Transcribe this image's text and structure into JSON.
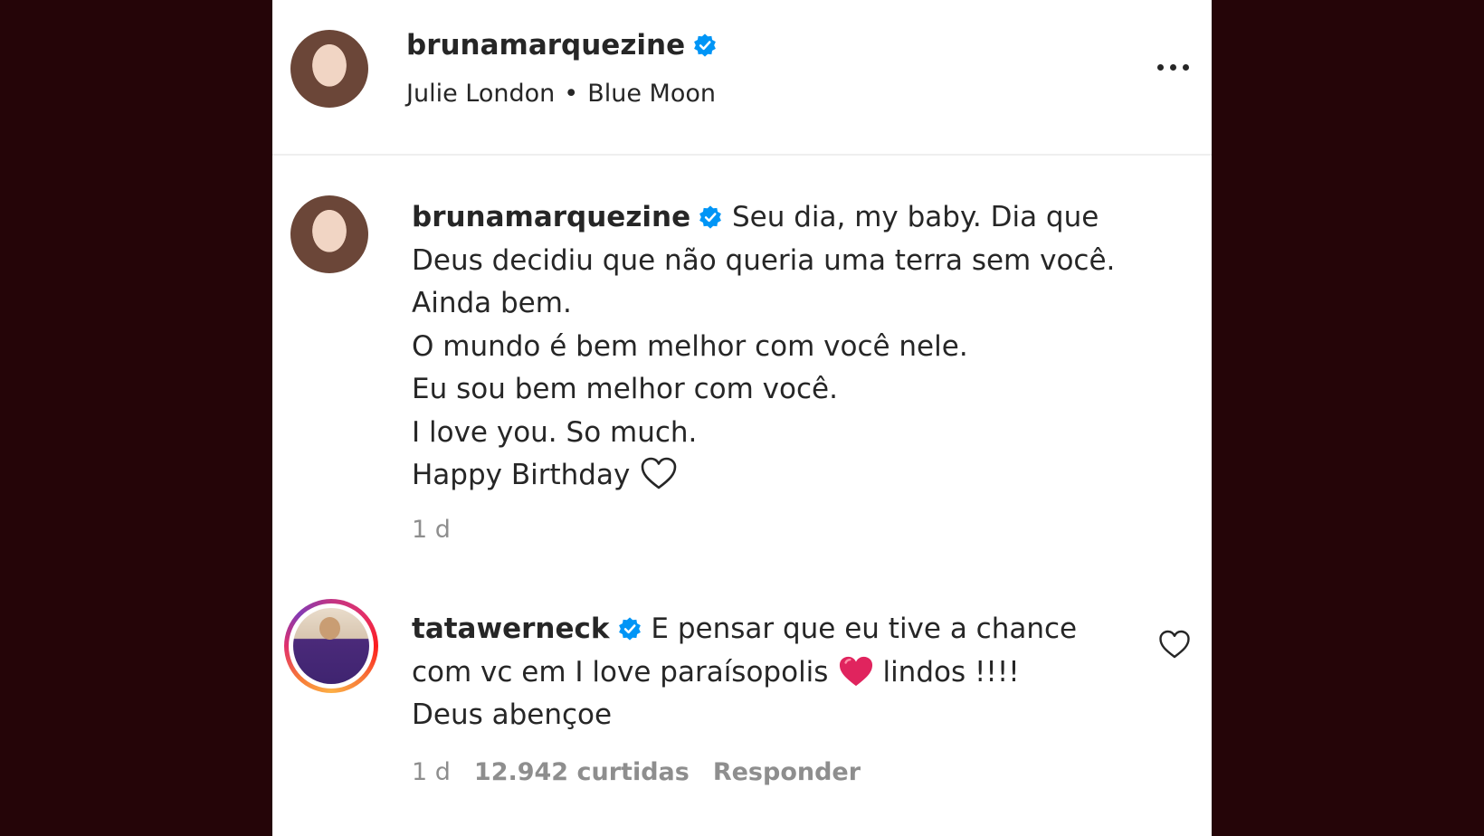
{
  "post_header": {
    "username": "brunamarquezine",
    "audio_artist": "Julie London",
    "separator": "•",
    "audio_title": "Blue Moon"
  },
  "caption": {
    "username": "brunamarquezine",
    "lines": [
      "Seu dia, my baby. Dia que",
      "Deus decidiu que não queria uma terra sem você.",
      "Ainda bem.",
      "O mundo é bem melhor com você nele.",
      "Eu sou bem melhor com você.",
      "I love you. So much.",
      "Happy Birthday"
    ],
    "time": "1 d"
  },
  "comment": {
    "username": "tatawerneck",
    "line1": "E pensar que eu tive a chance",
    "line2_before": "com vc em I love paraísopolis",
    "line2_after": "lindos !!!!",
    "line3": "Deus abençoe",
    "time": "1 d",
    "likes": "12.942 curtidas",
    "reply_label": "Responder"
  },
  "colors": {
    "background": "#250508",
    "panel": "#ffffff",
    "verified": "#0095f6",
    "heart_red": "#e0245e",
    "meta_text": "#8e8e8e"
  },
  "icons": [
    "verified-badge-icon",
    "more-options-icon",
    "heart-outline-icon",
    "red-heart-emoji-icon",
    "like-heart-icon"
  ]
}
